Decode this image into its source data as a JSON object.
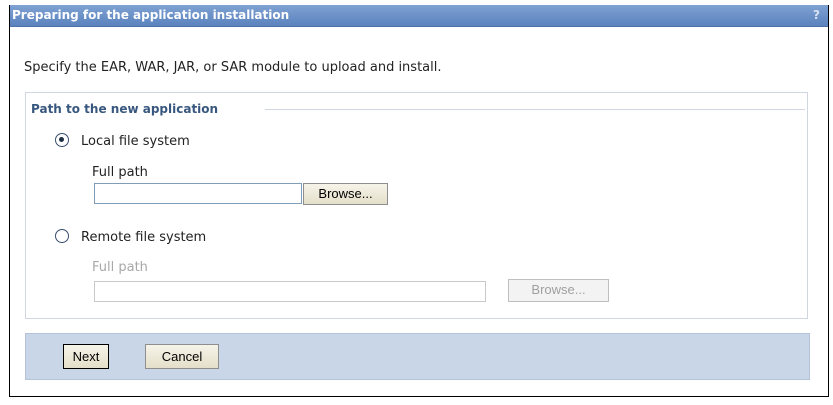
{
  "dialog": {
    "title": "Preparing for the application installation",
    "help_glyph": "?",
    "instruction": "Specify the EAR, WAR, JAR, or SAR module to upload and install."
  },
  "path_group": {
    "legend": "Path to the new application",
    "local": {
      "label": "Local file system",
      "selected": true,
      "full_path_label": "Full path",
      "full_path_value": "",
      "browse_label": "Browse..."
    },
    "remote": {
      "label": "Remote file system",
      "selected": false,
      "full_path_label": "Full path",
      "full_path_value": "",
      "browse_label": "Browse...",
      "disabled": true
    }
  },
  "footer": {
    "next_label": "Next",
    "cancel_label": "Cancel"
  },
  "colors": {
    "title_bar": "#5a82bd",
    "footer_bg": "#c9d6e8",
    "legend_text": "#38577e"
  }
}
